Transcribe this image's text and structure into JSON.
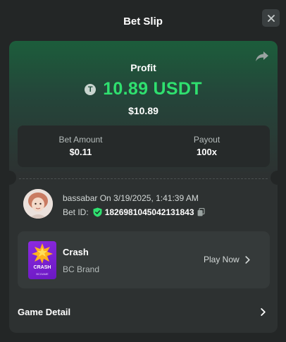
{
  "header": {
    "title": "Bet Slip",
    "close_icon": "close-icon"
  },
  "profit": {
    "label": "Profit",
    "coin_symbol": "T",
    "amount": "10.89 USDT",
    "usd_value": "$10.89",
    "color": "#2fe06f"
  },
  "stats": {
    "bet_amount_label": "Bet Amount",
    "bet_amount_value": "$0.11",
    "payout_label": "Payout",
    "payout_value": "100x"
  },
  "bet_info": {
    "username": "bassabar",
    "datetime_text": "On 3/19/2025, 1:41:39 AM",
    "bet_id_label": "Bet ID:",
    "bet_id_value": "1826981045042131843"
  },
  "game": {
    "name": "Crash",
    "brand": "BC Brand",
    "thumb_title": "CRASH",
    "thumb_subtitle": "BCGAME",
    "play_label": "Play Now"
  },
  "footer": {
    "game_detail_label": "Game Detail"
  }
}
